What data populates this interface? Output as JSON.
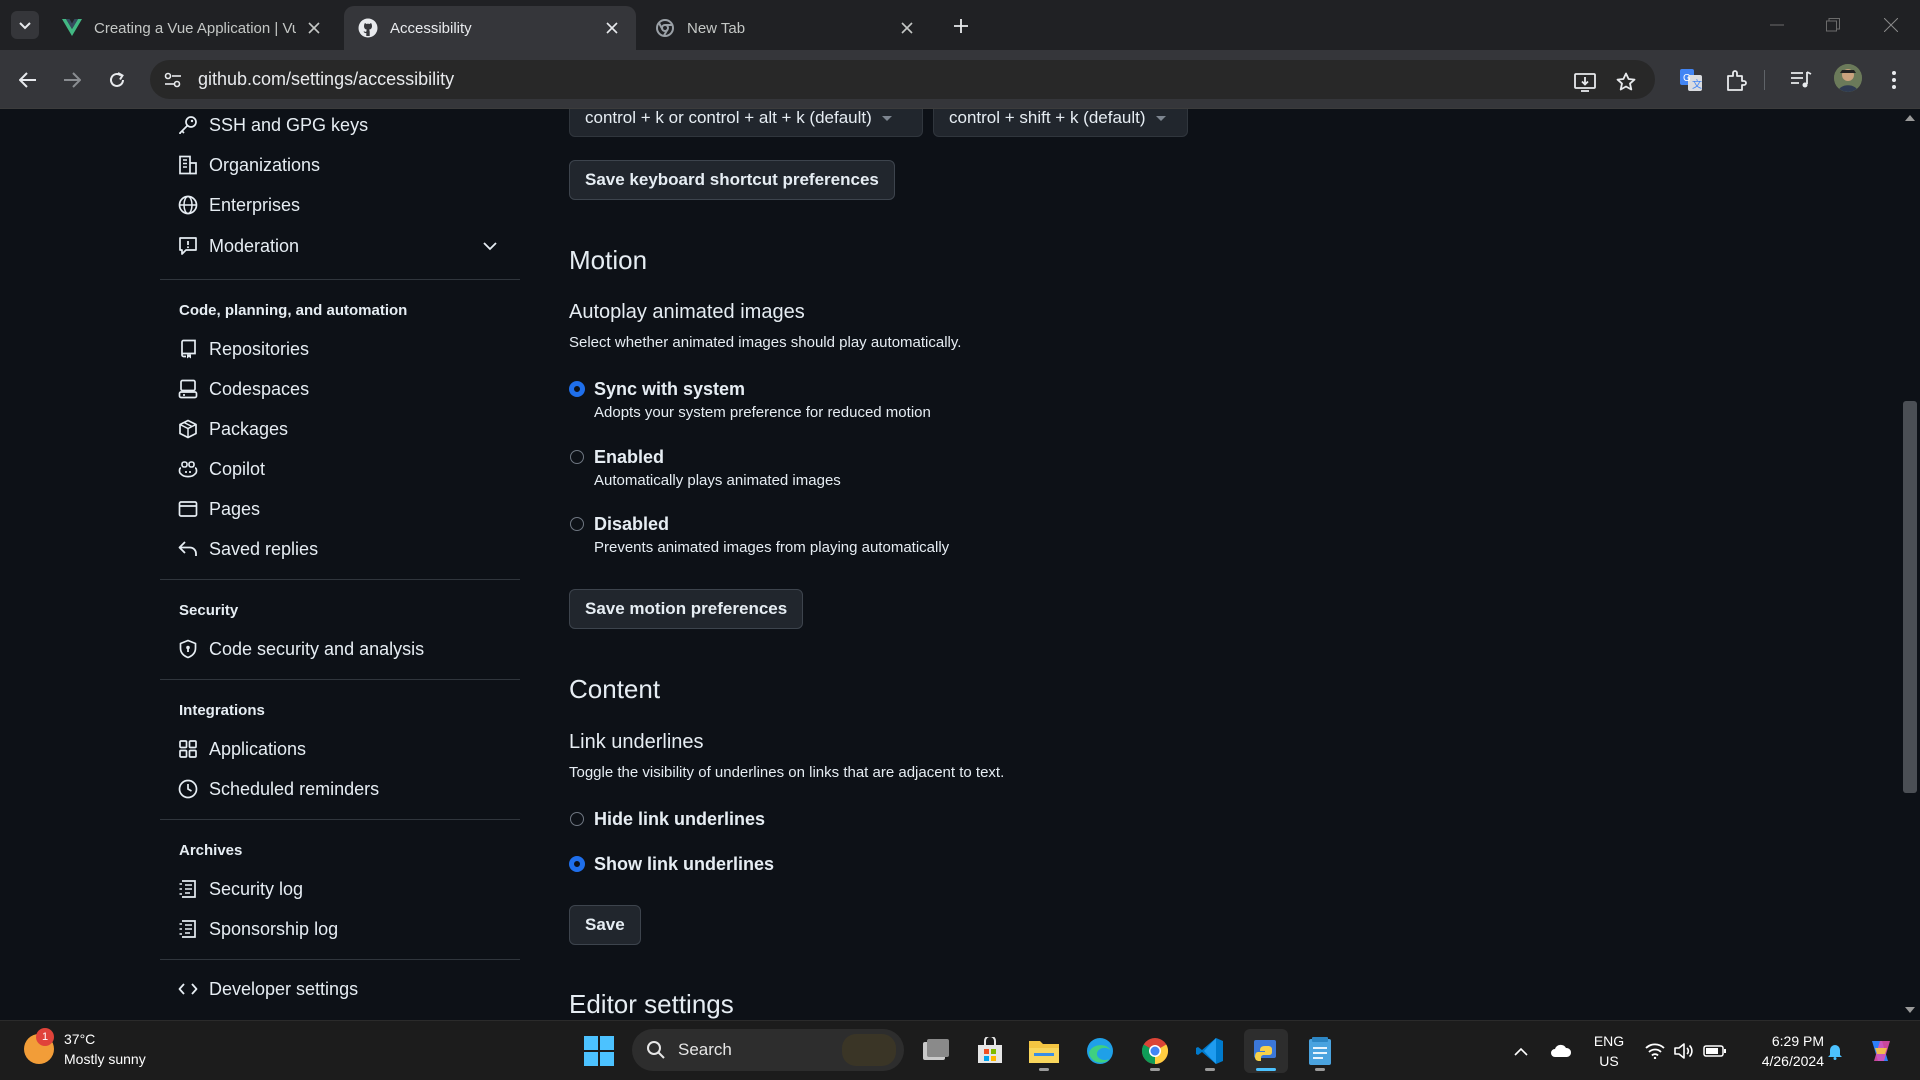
{
  "browser": {
    "tabs": [
      {
        "title": "Creating a Vue Application | Vue.js",
        "favicon": "vue-logo-icon",
        "active": false
      },
      {
        "title": "Accessibility",
        "favicon": "github-logo-icon",
        "active": true
      },
      {
        "title": "New Tab",
        "favicon": "chrome-logo-icon",
        "active": false
      }
    ],
    "url": "github.com/settings/accessibility"
  },
  "sidebar": {
    "top_items": [
      {
        "label": "SSH and GPG keys",
        "icon": "key-icon"
      },
      {
        "label": "Organizations",
        "icon": "organization-icon"
      },
      {
        "label": "Enterprises",
        "icon": "globe-icon"
      },
      {
        "label": "Moderation",
        "icon": "report-icon"
      }
    ],
    "sections": [
      {
        "heading": "Code, planning, and automation",
        "items": [
          {
            "label": "Repositories",
            "icon": "repo-icon"
          },
          {
            "label": "Codespaces",
            "icon": "codespaces-icon"
          },
          {
            "label": "Packages",
            "icon": "package-icon"
          },
          {
            "label": "Copilot",
            "icon": "copilot-icon"
          },
          {
            "label": "Pages",
            "icon": "browser-icon"
          },
          {
            "label": "Saved replies",
            "icon": "reply-icon"
          }
        ]
      },
      {
        "heading": "Security",
        "items": [
          {
            "label": "Code security and analysis",
            "icon": "shield-lock-icon"
          }
        ]
      },
      {
        "heading": "Integrations",
        "items": [
          {
            "label": "Applications",
            "icon": "apps-icon"
          },
          {
            "label": "Scheduled reminders",
            "icon": "clock-icon"
          }
        ]
      },
      {
        "heading": "Archives",
        "items": [
          {
            "label": "Security log",
            "icon": "log-icon"
          },
          {
            "label": "Sponsorship log",
            "icon": "log-icon"
          }
        ]
      }
    ],
    "developer": {
      "label": "Developer settings",
      "icon": "code-icon"
    }
  },
  "main": {
    "shortcut_selects": [
      "control + k or control + alt + k (default)",
      "control + shift + k (default)"
    ],
    "save_shortcuts": "Save keyboard shortcut preferences",
    "motion": {
      "title": "Motion",
      "subtitle": "Autoplay animated images",
      "description": "Select whether animated images should play automatically.",
      "options": [
        {
          "label": "Sync with system",
          "note": "Adopts your system preference for reduced motion",
          "checked": true
        },
        {
          "label": "Enabled",
          "note": "Automatically plays animated images",
          "checked": false
        },
        {
          "label": "Disabled",
          "note": "Prevents animated images from playing automatically",
          "checked": false
        }
      ],
      "save": "Save motion preferences"
    },
    "content": {
      "title": "Content",
      "subtitle": "Link underlines",
      "description": "Toggle the visibility of underlines on links that are adjacent to text.",
      "options": [
        {
          "label": "Hide link underlines",
          "checked": false
        },
        {
          "label": "Show link underlines",
          "checked": true
        }
      ],
      "save": "Save"
    },
    "editor_title": "Editor settings"
  },
  "taskbar": {
    "weather": {
      "temp": "37°C",
      "condition": "Mostly sunny",
      "badge": "1"
    },
    "search_placeholder": "Search",
    "apps": [
      "task-view-icon",
      "store-icon",
      "file-explorer-icon",
      "edge-icon",
      "chrome-icon",
      "vscode-icon",
      "python-app-icon",
      "notepad-icon"
    ],
    "lang": "ENG",
    "region": "US",
    "time": "6:29 PM",
    "date": "4/26/2024"
  }
}
